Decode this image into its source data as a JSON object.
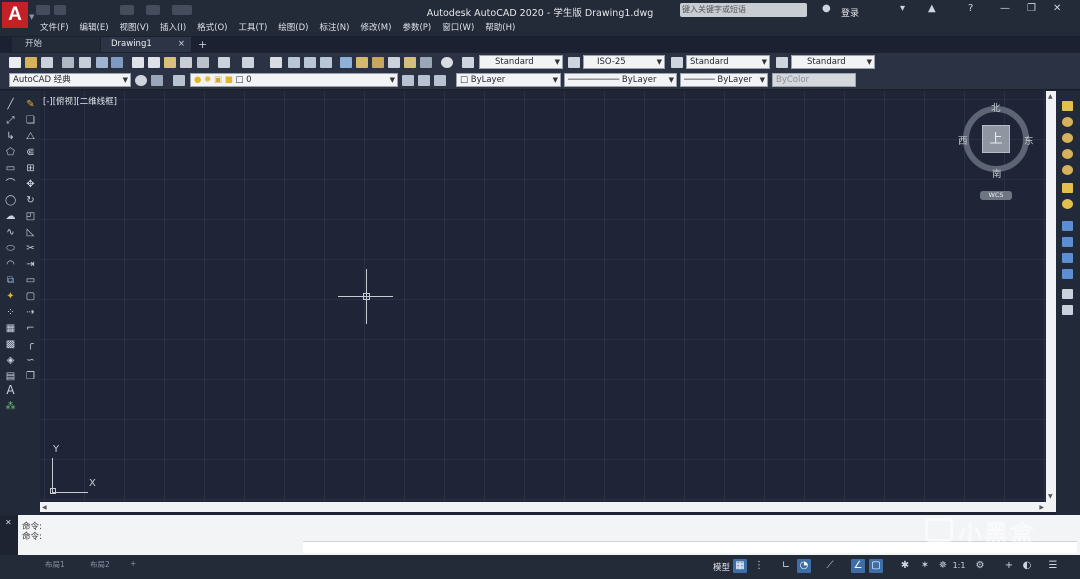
{
  "app": {
    "logo": "A",
    "title": "Autodesk AutoCAD 2020 - 学生版    Drawing1.dwg",
    "search_placeholder": "键入关键字或短语",
    "login": "登录"
  },
  "menu": [
    "文件(F)",
    "编辑(E)",
    "视图(V)",
    "插入(I)",
    "格式(O)",
    "工具(T)",
    "绘图(D)",
    "标注(N)",
    "修改(M)",
    "参数(P)",
    "窗口(W)",
    "帮助(H)"
  ],
  "tabs": {
    "start": "开始",
    "drawing": "Drawing1",
    "close": "×",
    "add": "+"
  },
  "toolbar1": {
    "text_style": "Standard",
    "dim_style": "ISO-25",
    "table_style": "Standard",
    "mleader_style": "Standard"
  },
  "toolbar2": {
    "workspace": "AutoCAD 经典",
    "layer": "0",
    "color": "ByLayer",
    "linetype": "ByLayer",
    "lineweight": "ByLayer",
    "plotstyle": "ByColor"
  },
  "viewport": {
    "label": "[-][俯视][二维线框]",
    "viewcube": {
      "face": "上",
      "north": "北",
      "south": "南",
      "east": "东",
      "west": "西",
      "wcs": "WCS"
    },
    "ucs": {
      "x": "X",
      "y": "Y"
    }
  },
  "command": {
    "history1": "命令:",
    "history2": "命令:"
  },
  "statusbar": {
    "model": "模型",
    "layout1": "布局1",
    "layout2": "布局2",
    "scale": "1:1"
  },
  "watermark": "小黑盒",
  "colors": {
    "accent": "#c42127",
    "canvas": "#1f2536",
    "chrome": "#2b3243",
    "active": "#3d6ea8"
  }
}
